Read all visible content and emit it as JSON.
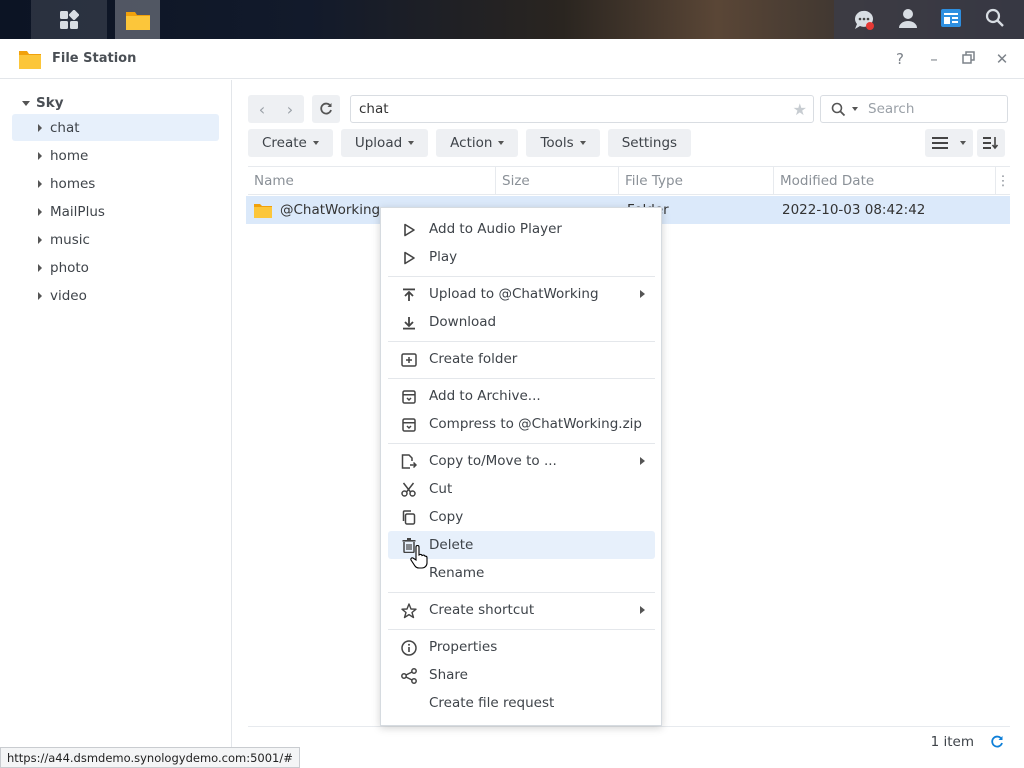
{
  "window": {
    "title": "File Station"
  },
  "sidebar": {
    "root": "Sky",
    "items": [
      {
        "label": "chat",
        "selected": true
      },
      {
        "label": "home",
        "selected": false
      },
      {
        "label": "homes",
        "selected": false
      },
      {
        "label": "MailPlus",
        "selected": false
      },
      {
        "label": "music",
        "selected": false
      },
      {
        "label": "photo",
        "selected": false
      },
      {
        "label": "video",
        "selected": false
      }
    ]
  },
  "path": {
    "value": "chat"
  },
  "search": {
    "placeholder": "Search"
  },
  "toolbar": {
    "create": "Create",
    "upload": "Upload",
    "action": "Action",
    "tools": "Tools",
    "settings": "Settings"
  },
  "table": {
    "headers": [
      "Name",
      "Size",
      "File Type",
      "Modified Date"
    ],
    "rows": [
      {
        "name": "@ChatWorking",
        "size": "",
        "type": "Folder",
        "modified": "2022-10-03 08:42:42"
      }
    ]
  },
  "footer": {
    "count": "1 item"
  },
  "context_menu": {
    "items": [
      {
        "label": "Add to Audio Player",
        "icon": "play-outline-icon"
      },
      {
        "label": "Play",
        "icon": "play-outline-icon"
      },
      {
        "label": "Upload to @ChatWorking",
        "icon": "upload-icon",
        "submenu": true
      },
      {
        "label": "Download",
        "icon": "download-icon"
      },
      {
        "label": "Create folder",
        "icon": "folder-plus-icon"
      },
      {
        "label": "Add to Archive...",
        "icon": "archive-icon"
      },
      {
        "label": "Compress to @ChatWorking.zip",
        "icon": "archive-icon"
      },
      {
        "label": "Copy to/Move to ...",
        "icon": "copy-move-icon",
        "submenu": true
      },
      {
        "label": "Cut",
        "icon": "scissors-icon"
      },
      {
        "label": "Copy",
        "icon": "copy-icon"
      },
      {
        "label": "Delete",
        "icon": "trash-icon",
        "hover": true
      },
      {
        "label": "Rename",
        "icon": ""
      },
      {
        "label": "Create shortcut",
        "icon": "star-icon",
        "submenu": true
      },
      {
        "label": "Properties",
        "icon": "info-icon"
      },
      {
        "label": "Share",
        "icon": "share-icon"
      },
      {
        "label": "Create file request",
        "icon": ""
      }
    ]
  },
  "status_url": "https://a44.dsmdemo.synologydemo.com:5001/#",
  "colors": {
    "accent": "#0e7fd8",
    "selection": "#dbe9fa",
    "hover": "#e7f0fb",
    "folder": "#f6b51e"
  }
}
